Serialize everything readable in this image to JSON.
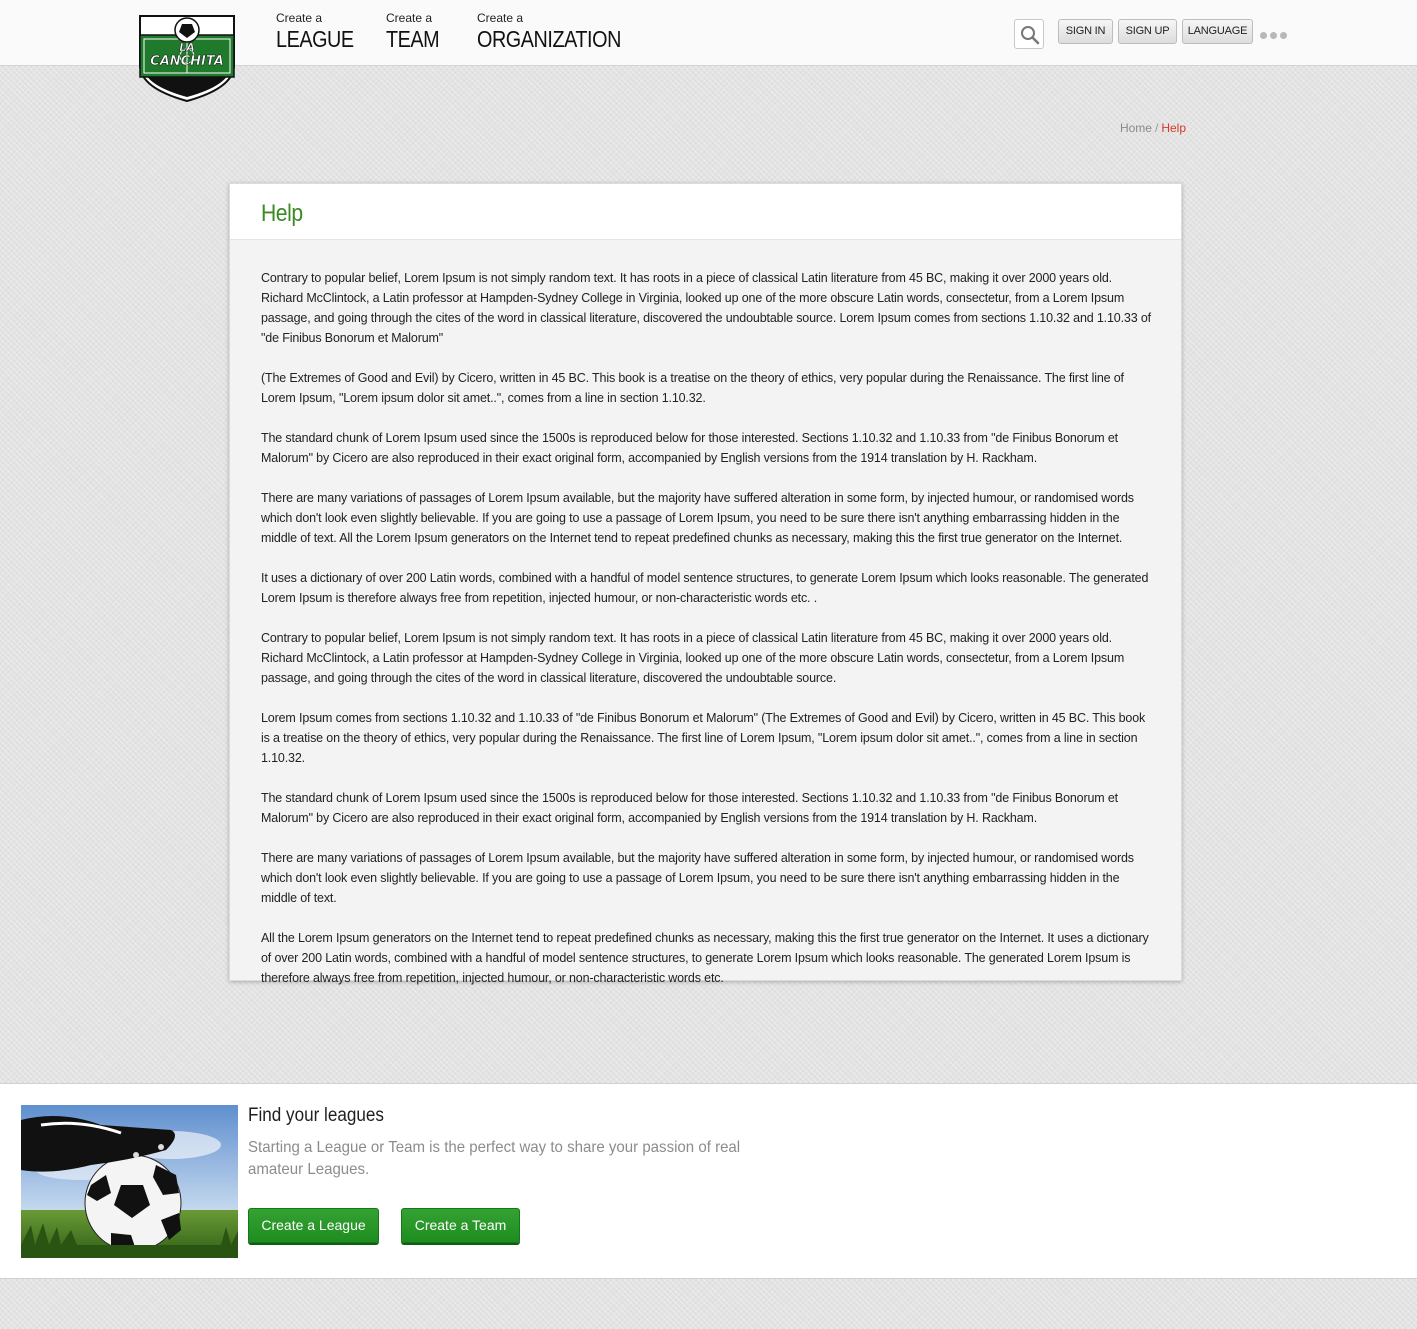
{
  "brand": {
    "logo_line1": "LA",
    "logo_line2": "CANCHITA"
  },
  "nav": {
    "items": [
      {
        "small": "Create a",
        "big": "LEAGUE"
      },
      {
        "small": "Create a",
        "big": "TEAM"
      },
      {
        "small": "Create a",
        "big": "ORGANIZATION"
      }
    ]
  },
  "header_buttons": {
    "sign_in": "SIGN IN",
    "sign_up": "SIGN UP",
    "language": "LANGUAGE"
  },
  "breadcrumb": {
    "home": "Home",
    "separator": "/",
    "current": "Help"
  },
  "page": {
    "title": "Help",
    "paragraphs": [
      "Contrary to popular belief, Lorem Ipsum is not simply random text. It has roots in a piece of classical Latin literature from 45 BC, making it over 2000 years old. Richard McClintock, a Latin professor at Hampden-Sydney College in Virginia, looked up one of the more obscure Latin words, consectetur, from a Lorem Ipsum passage, and going through the cites of the word in classical literature, discovered the undoubtable source. Lorem Ipsum comes from sections 1.10.32 and 1.10.33 of \"de Finibus Bonorum et Malorum\"",
      "(The Extremes of Good and Evil) by Cicero, written in 45 BC. This book is a treatise on the theory of ethics, very popular during the Renaissance. The first line of Lorem Ipsum, \"Lorem ipsum dolor sit amet..\", comes from a line in section 1.10.32.",
      "The standard chunk of Lorem Ipsum used since the 1500s is reproduced below for those interested. Sections 1.10.32 and 1.10.33 from \"de Finibus Bonorum et Malorum\" by Cicero are also reproduced in their exact original form, accompanied by English versions from the 1914 translation by H. Rackham.",
      "There are many variations of passages of Lorem Ipsum available, but the majority have suffered alteration in some form, by injected humour, or randomised words which don't look even slightly believable. If you are going to use a passage of Lorem Ipsum, you need to be sure there isn't anything embarrassing hidden in the middle of text. All the Lorem Ipsum generators on the Internet tend to repeat predefined chunks as necessary, making this the first true generator on the Internet.",
      "It uses a dictionary of over 200 Latin words, combined with a handful of model sentence structures, to generate Lorem Ipsum which looks reasonable. The generated Lorem Ipsum is therefore always free from repetition, injected humour, or non-characteristic words etc. .",
      "Contrary to popular belief, Lorem Ipsum is not simply random text. It has roots in a piece of classical Latin literature from 45 BC, making it over 2000 years old. Richard McClintock, a Latin professor at Hampden-Sydney College in Virginia, looked up one of the more obscure Latin words, consectetur, from a Lorem Ipsum passage, and going through the cites of the word in classical literature, discovered the undoubtable source.",
      "Lorem Ipsum comes from sections 1.10.32 and 1.10.33 of \"de Finibus Bonorum et Malorum\" (The Extremes of Good and Evil) by Cicero, written in 45 BC. This book is a treatise on the theory of ethics, very popular during the Renaissance. The first line of Lorem Ipsum, \"Lorem ipsum dolor sit amet..\", comes from a line in section 1.10.32.",
      "The standard chunk of Lorem Ipsum used since the 1500s is reproduced below for those interested. Sections 1.10.32 and 1.10.33 from \"de Finibus Bonorum et Malorum\" by Cicero are also reproduced in their exact original form, accompanied by English versions from the 1914 translation by H. Rackham.",
      "There are many variations of passages of Lorem Ipsum available, but the majority have suffered alteration in some form, by injected humour, or randomised words which don't look even slightly believable. If you are going to use a passage of Lorem Ipsum, you need to be sure there isn't anything embarrassing hidden in the middle of text.",
      "All the Lorem Ipsum generators on the Internet tend to repeat predefined chunks as necessary, making this the first true generator on the Internet. It uses a dictionary of over 200 Latin words, combined with a handful of model sentence structures, to generate Lorem Ipsum which looks reasonable. The generated Lorem Ipsum is therefore always free from repetition, injected humour, or non-characteristic words etc."
    ]
  },
  "promo": {
    "title": "Find your leagues",
    "text": "Starting a League or Team is the perfect way to share your passion of real amateur Leagues.",
    "create_league": "Create a League",
    "create_team": "Create a Team"
  },
  "colors": {
    "accent_green": "#3c8a22",
    "button_green": "#2a9a29",
    "breadcrumb_active": "#d6382b"
  },
  "icons": {
    "search": "search-icon",
    "more": "more-dots-icon",
    "logo": "la-canchita-shield-logo"
  }
}
